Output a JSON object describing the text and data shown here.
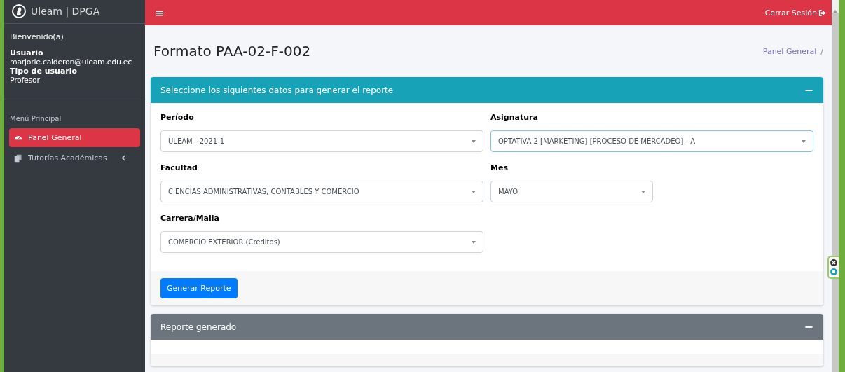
{
  "sidebar": {
    "brand": "Uleam | DPGA",
    "welcome": "Bienvenido(a)",
    "user_info": [
      {
        "label": "Usuario",
        "value": "marjorie.calderon@uleam.edu.ec"
      },
      {
        "label": "Tipo de usuario",
        "value": "Profesor"
      }
    ],
    "menu_header": "Menú Principal",
    "items": [
      {
        "label": "Panel General",
        "selected": true,
        "expandable": false
      },
      {
        "label": "Tutorías Académicas",
        "selected": false,
        "expandable": true
      }
    ]
  },
  "topbar": {
    "menu_glyph": "≡",
    "logout": "Cerrar Sesión"
  },
  "page": {
    "title": "Formato PAA-02-F-002",
    "breadcrumb": [
      "Panel General",
      "/"
    ]
  },
  "cards": [
    {
      "title": "Seleccione los siguientes datos para generar el reporte",
      "collapse_glyph": "−",
      "fields": [
        {
          "label": "Período",
          "value": "ULEAM - 2021-1",
          "focused": false
        },
        {
          "label": "Asignatura",
          "value": "OPTATIVA 2 [MARKETING] [PROCESO DE MERCADEO] - A",
          "focused": true
        },
        {
          "label": "Facultad",
          "value": "CIENCIAS ADMINISTRATIVAS, CONTABLES Y COMERCIO",
          "focused": false
        },
        {
          "label": "Mes",
          "value": "MAYO",
          "focused": false
        },
        {
          "label": "Carrera/Malla",
          "value": "COMERCIO EXTERIOR (Creditos)",
          "focused": false
        }
      ],
      "button": "Generar Reporte"
    },
    {
      "title": "Reporte generado",
      "collapse_glyph": "−"
    }
  ]
}
